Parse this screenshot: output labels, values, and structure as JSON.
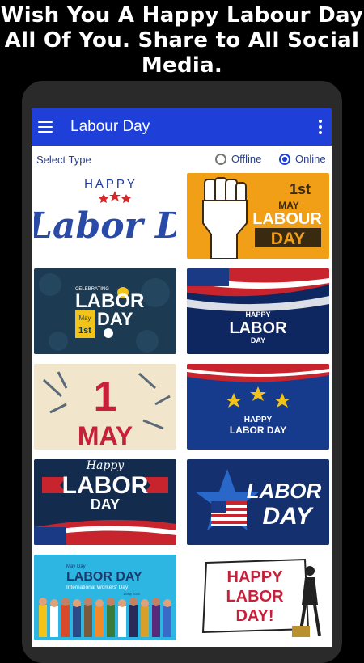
{
  "promo": {
    "line1": "Wish You A Happy Labour Day",
    "line2": "All Of You. Share to All Social",
    "line3": "Media."
  },
  "appbar": {
    "title": "Labour Day",
    "menu_icon": "hamburger-icon",
    "overflow_icon": "more-vert-icon"
  },
  "type_selector": {
    "label": "Select Type",
    "options": [
      {
        "label": "Offline",
        "selected": false
      },
      {
        "label": "Online",
        "selected": true
      }
    ]
  },
  "colors": {
    "appbar": "#1e40d8",
    "accent": "#1e40d8"
  },
  "cards": [
    {
      "id": "c1",
      "texts": [
        "HAPPY",
        "Labor Day"
      ]
    },
    {
      "id": "c2",
      "texts": [
        "1st",
        "MAY",
        "LABOUR",
        "DAY"
      ]
    },
    {
      "id": "c3",
      "texts": [
        "CELEBRATING",
        "LABOR",
        "DAY",
        "May",
        "1st"
      ]
    },
    {
      "id": "c4",
      "texts": [
        "HAPPY",
        "LABOR",
        "DAY"
      ]
    },
    {
      "id": "c5",
      "texts": [
        "1",
        "MAY"
      ]
    },
    {
      "id": "c6",
      "texts": [
        "HAPPY",
        "LABOR DAY"
      ]
    },
    {
      "id": "c7",
      "texts": [
        "Happy",
        "LABOR",
        "DAY"
      ]
    },
    {
      "id": "c8",
      "texts": [
        "LABOR",
        "DAY"
      ]
    },
    {
      "id": "c9",
      "texts": [
        "May Day",
        "LABOR DAY",
        "International Workers' Day",
        "1 May 2020"
      ]
    },
    {
      "id": "c10",
      "texts": [
        "HAPPY",
        "LABOR",
        "DAY!"
      ]
    }
  ]
}
